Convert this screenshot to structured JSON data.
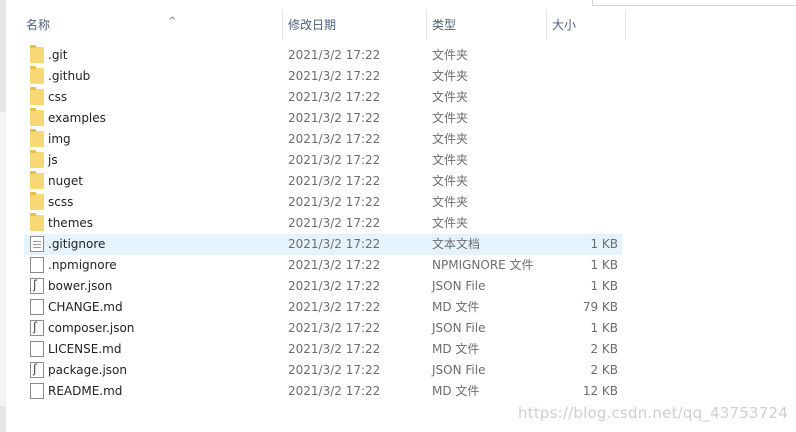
{
  "columns": {
    "name": "名称",
    "date": "修改日期",
    "type": "类型",
    "size": "大小"
  },
  "files": [
    {
      "name": ".git",
      "date": "2021/3/2 17:22",
      "type": "文件夹",
      "size": "",
      "icon": "folder-icon"
    },
    {
      "name": ".github",
      "date": "2021/3/2 17:22",
      "type": "文件夹",
      "size": "",
      "icon": "folder-icon"
    },
    {
      "name": "css",
      "date": "2021/3/2 17:22",
      "type": "文件夹",
      "size": "",
      "icon": "folder-icon"
    },
    {
      "name": "examples",
      "date": "2021/3/2 17:22",
      "type": "文件夹",
      "size": "",
      "icon": "folder-icon"
    },
    {
      "name": "img",
      "date": "2021/3/2 17:22",
      "type": "文件夹",
      "size": "",
      "icon": "folder-icon"
    },
    {
      "name": "js",
      "date": "2021/3/2 17:22",
      "type": "文件夹",
      "size": "",
      "icon": "folder-icon"
    },
    {
      "name": "nuget",
      "date": "2021/3/2 17:22",
      "type": "文件夹",
      "size": "",
      "icon": "folder-icon"
    },
    {
      "name": "scss",
      "date": "2021/3/2 17:22",
      "type": "文件夹",
      "size": "",
      "icon": "folder-icon"
    },
    {
      "name": "themes",
      "date": "2021/3/2 17:22",
      "type": "文件夹",
      "size": "",
      "icon": "folder-icon"
    },
    {
      "name": ".gitignore",
      "date": "2021/3/2 17:22",
      "type": "文本文档",
      "size": "1 KB",
      "icon": "text-file-icon"
    },
    {
      "name": ".npmignore",
      "date": "2021/3/2 17:22",
      "type": "NPMIGNORE 文件",
      "size": "1 KB",
      "icon": "blank-file-icon"
    },
    {
      "name": "bower.json",
      "date": "2021/3/2 17:22",
      "type": "JSON File",
      "size": "1 KB",
      "icon": "json-file-icon"
    },
    {
      "name": "CHANGE.md",
      "date": "2021/3/2 17:22",
      "type": "MD 文件",
      "size": "79 KB",
      "icon": "blank-file-icon"
    },
    {
      "name": "composer.json",
      "date": "2021/3/2 17:22",
      "type": "JSON File",
      "size": "1 KB",
      "icon": "json-file-icon"
    },
    {
      "name": "LICENSE.md",
      "date": "2021/3/2 17:22",
      "type": "MD 文件",
      "size": "2 KB",
      "icon": "blank-file-icon"
    },
    {
      "name": "package.json",
      "date": "2021/3/2 17:22",
      "type": "JSON File",
      "size": "2 KB",
      "icon": "json-file-icon"
    },
    {
      "name": "README.md",
      "date": "2021/3/2 17:22",
      "type": "MD 文件",
      "size": "12 KB",
      "icon": "blank-file-icon"
    }
  ],
  "selected_index": 9,
  "sort_indicator": "^",
  "watermark": "https://blog.csdn.net/qq_43753724"
}
